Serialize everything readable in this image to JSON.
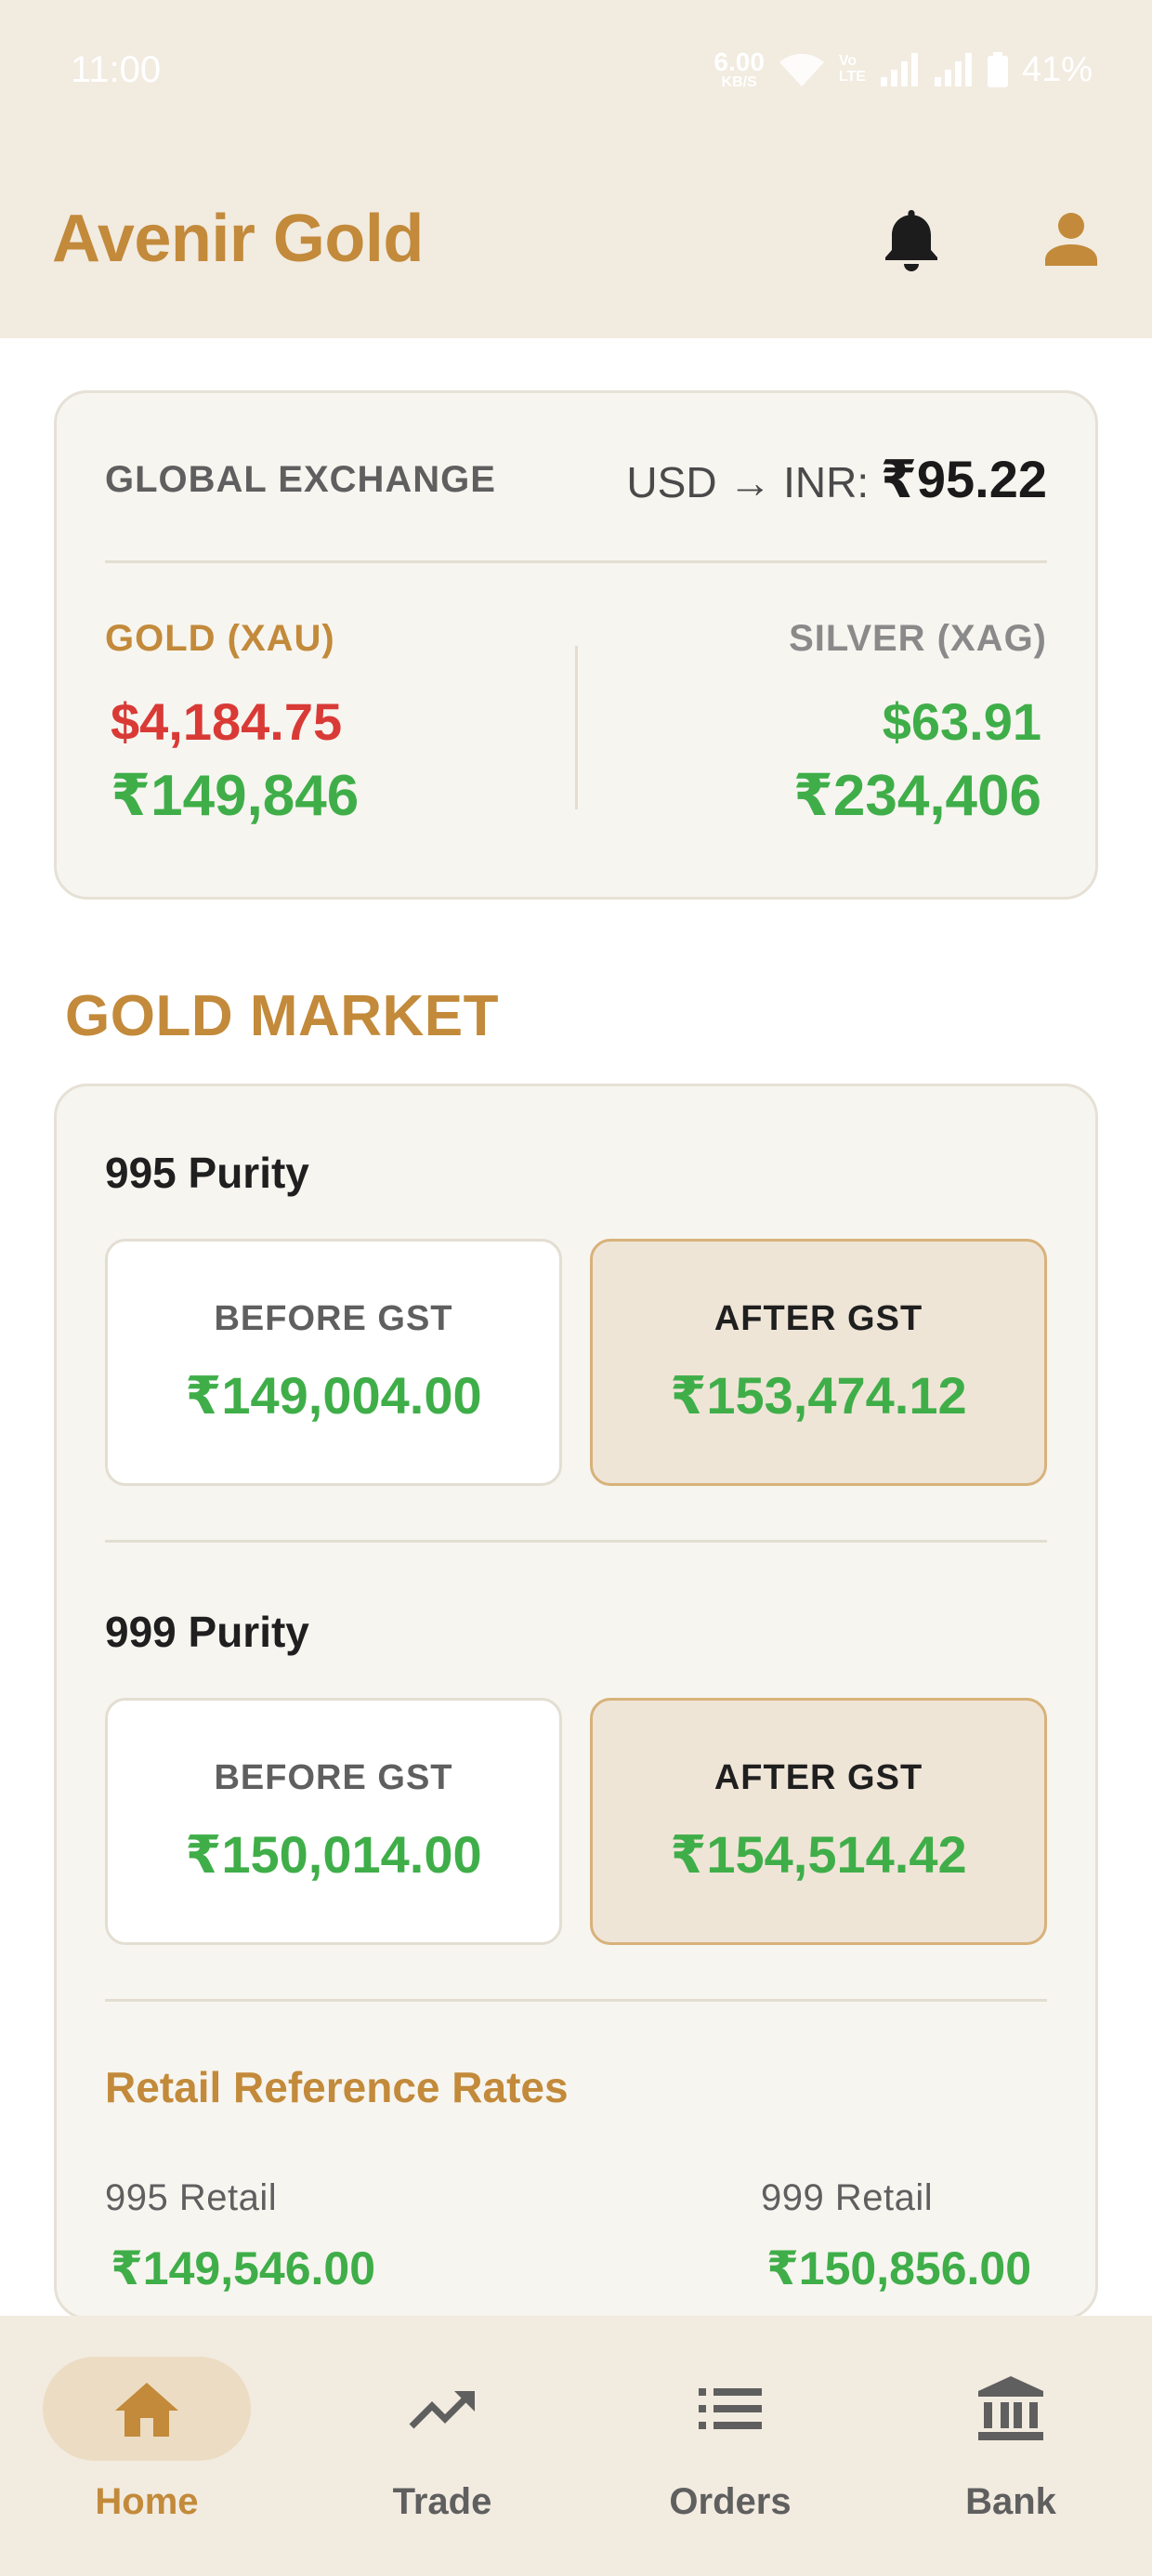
{
  "status_bar": {
    "time": "11:00",
    "net_speed": "6.00",
    "net_unit": "KB/S",
    "volte": [
      "Vo",
      "LTE"
    ],
    "battery": "41%"
  },
  "app_bar": {
    "title": "Avenir Gold",
    "icons": [
      "bell-icon",
      "profile-icon"
    ]
  },
  "exchange": {
    "label": "GLOBAL EXCHANGE",
    "pair": "USD → INR:",
    "rate": "₹95.22",
    "gold": {
      "name": "GOLD (XAU)",
      "usd": "$4,184.75",
      "inr": "₹149,846"
    },
    "silver": {
      "name": "SILVER (XAG)",
      "usd": "$63.91",
      "inr": "₹234,406"
    }
  },
  "gold_market": {
    "title": "GOLD MARKET",
    "purities": [
      {
        "title": "995 Purity",
        "before_label": "BEFORE GST",
        "before_value": "₹149,004.00",
        "after_label": "AFTER GST",
        "after_value": "₹153,474.12"
      },
      {
        "title": "999 Purity",
        "before_label": "BEFORE GST",
        "before_value": "₹150,014.00",
        "after_label": "AFTER GST",
        "after_value": "₹154,514.42"
      }
    ],
    "retail": {
      "title": "Retail Reference Rates",
      "items": [
        {
          "name": "995 Retail",
          "value": "₹149,546.00"
        },
        {
          "name": "999 Retail",
          "value": "₹150,856.00"
        }
      ]
    }
  },
  "bottom_nav": [
    {
      "label": "Home",
      "icon": "home-icon",
      "active": true
    },
    {
      "label": "Trade",
      "icon": "trending-up-icon",
      "active": false
    },
    {
      "label": "Orders",
      "icon": "list-icon",
      "active": false
    },
    {
      "label": "Bank",
      "icon": "bank-icon",
      "active": false
    }
  ],
  "colors": {
    "accent": "#c28a3a",
    "header_bg": "#f2ebe0",
    "positive": "#3fae49",
    "negative": "#d93a36",
    "card_bg": "#f7f5f0"
  }
}
